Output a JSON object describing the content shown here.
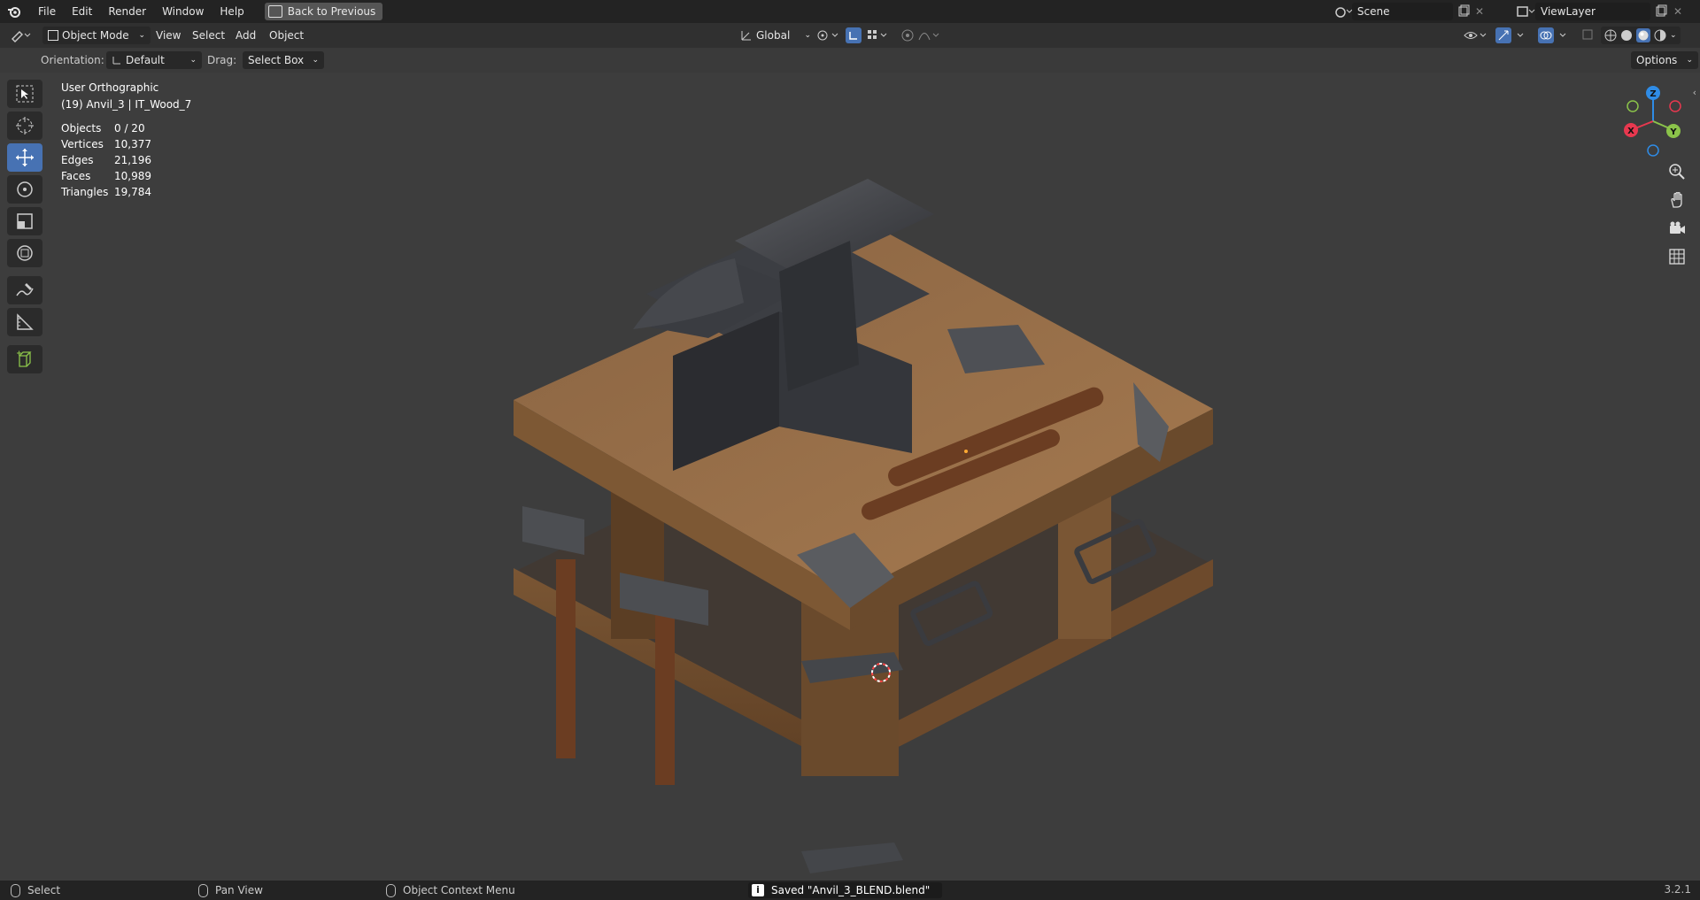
{
  "menu": {
    "items": [
      "File",
      "Edit",
      "Render",
      "Window",
      "Help"
    ],
    "back_label": "Back to Previous"
  },
  "workspace": {
    "scene_label": "Scene",
    "viewlayer_label": "ViewLayer"
  },
  "header": {
    "mode": "Object Mode",
    "menus": [
      "View",
      "Select",
      "Add",
      "Object"
    ],
    "transform_orientation": "Global",
    "options_label": "Options"
  },
  "tool_settings": {
    "orientation_label": "Orientation:",
    "orientation_value": "Default",
    "drag_label": "Drag:",
    "drag_value": "Select Box"
  },
  "viewport": {
    "view_name": "User Orthographic",
    "object_info": "(19) Anvil_3 | IT_Wood_7",
    "stats": [
      {
        "label": "Objects",
        "value": "0 / 20"
      },
      {
        "label": "Vertices",
        "value": "10,377"
      },
      {
        "label": "Edges",
        "value": "21,196"
      },
      {
        "label": "Faces",
        "value": "10,989"
      },
      {
        "label": "Triangles",
        "value": "19,784"
      }
    ],
    "gizmo": {
      "x": "X",
      "y": "Y",
      "z": "Z"
    }
  },
  "statusbar": {
    "select": "Select",
    "pan": "Pan View",
    "context": "Object Context Menu",
    "saved_message": "Saved \"Anvil_3_BLEND.blend\"",
    "version": "3.2.1"
  },
  "colors": {
    "accent": "#4772b3",
    "topbar": "#232323",
    "viewport": "#3d3d3d",
    "axis_x": "#e8384f",
    "axis_y": "#8bc34a",
    "axis_z": "#2f8ce6"
  }
}
